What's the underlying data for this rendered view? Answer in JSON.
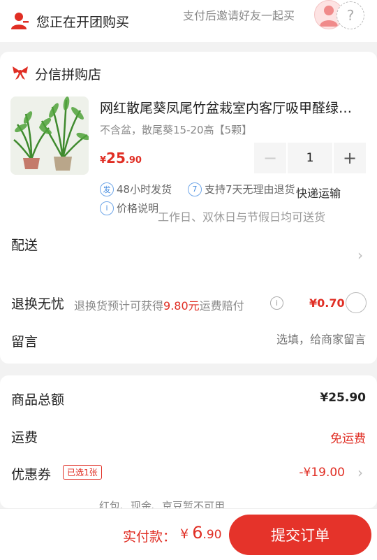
{
  "header": {
    "title": "您正在开团购买",
    "hint": "支付后邀请好友一起买",
    "empty_slot_symbol": "?"
  },
  "shop": {
    "name": "分信拼购店"
  },
  "product": {
    "title": "网红散尾葵凤尾竹盆栽室内客厅吸甲醛绿植大型植物",
    "spec": "不含盆，散尾葵15-20高【5颗】",
    "price_currency": "¥",
    "price_int": "25",
    "price_dec": ".90",
    "quantity": "1",
    "minus_symbol": "−",
    "plus_symbol": "+"
  },
  "services": [
    {
      "badge": "发",
      "label": "48小时发货"
    },
    {
      "badge": "7",
      "label": "支持7天无理由退货"
    },
    {
      "badge": "i",
      "label": "价格说明"
    }
  ],
  "delivery": {
    "label": "配送",
    "method": "快递运输",
    "note": "工作日、双休日与节假日均可送货"
  },
  "return_insurance": {
    "label": "退换无忧",
    "desc_prefix": "退换货预计可获得",
    "desc_amount": "9.80元",
    "desc_suffix": "运费赔付",
    "info_symbol": "i",
    "price": "¥0.70"
  },
  "message": {
    "label": "留言",
    "placeholder": "选填，给商家留言"
  },
  "summary": {
    "total_label": "商品总额",
    "total_value": "¥25.90",
    "shipping_label": "运费",
    "shipping_value": "免运费",
    "coupon_label": "优惠券",
    "coupon_badge": "已选1张",
    "coupon_value": "-¥19.00",
    "more_text": "红包、现金、京豆暂不可用"
  },
  "footer": {
    "pay_label": "实付款：",
    "pay_currency": "¥",
    "pay_int": "6",
    "pay_dec": ".90",
    "submit_label": "提交订单"
  },
  "colors": {
    "accent": "#e02e24",
    "button": "#e5332a",
    "service_icon": "#4a8fe0"
  }
}
